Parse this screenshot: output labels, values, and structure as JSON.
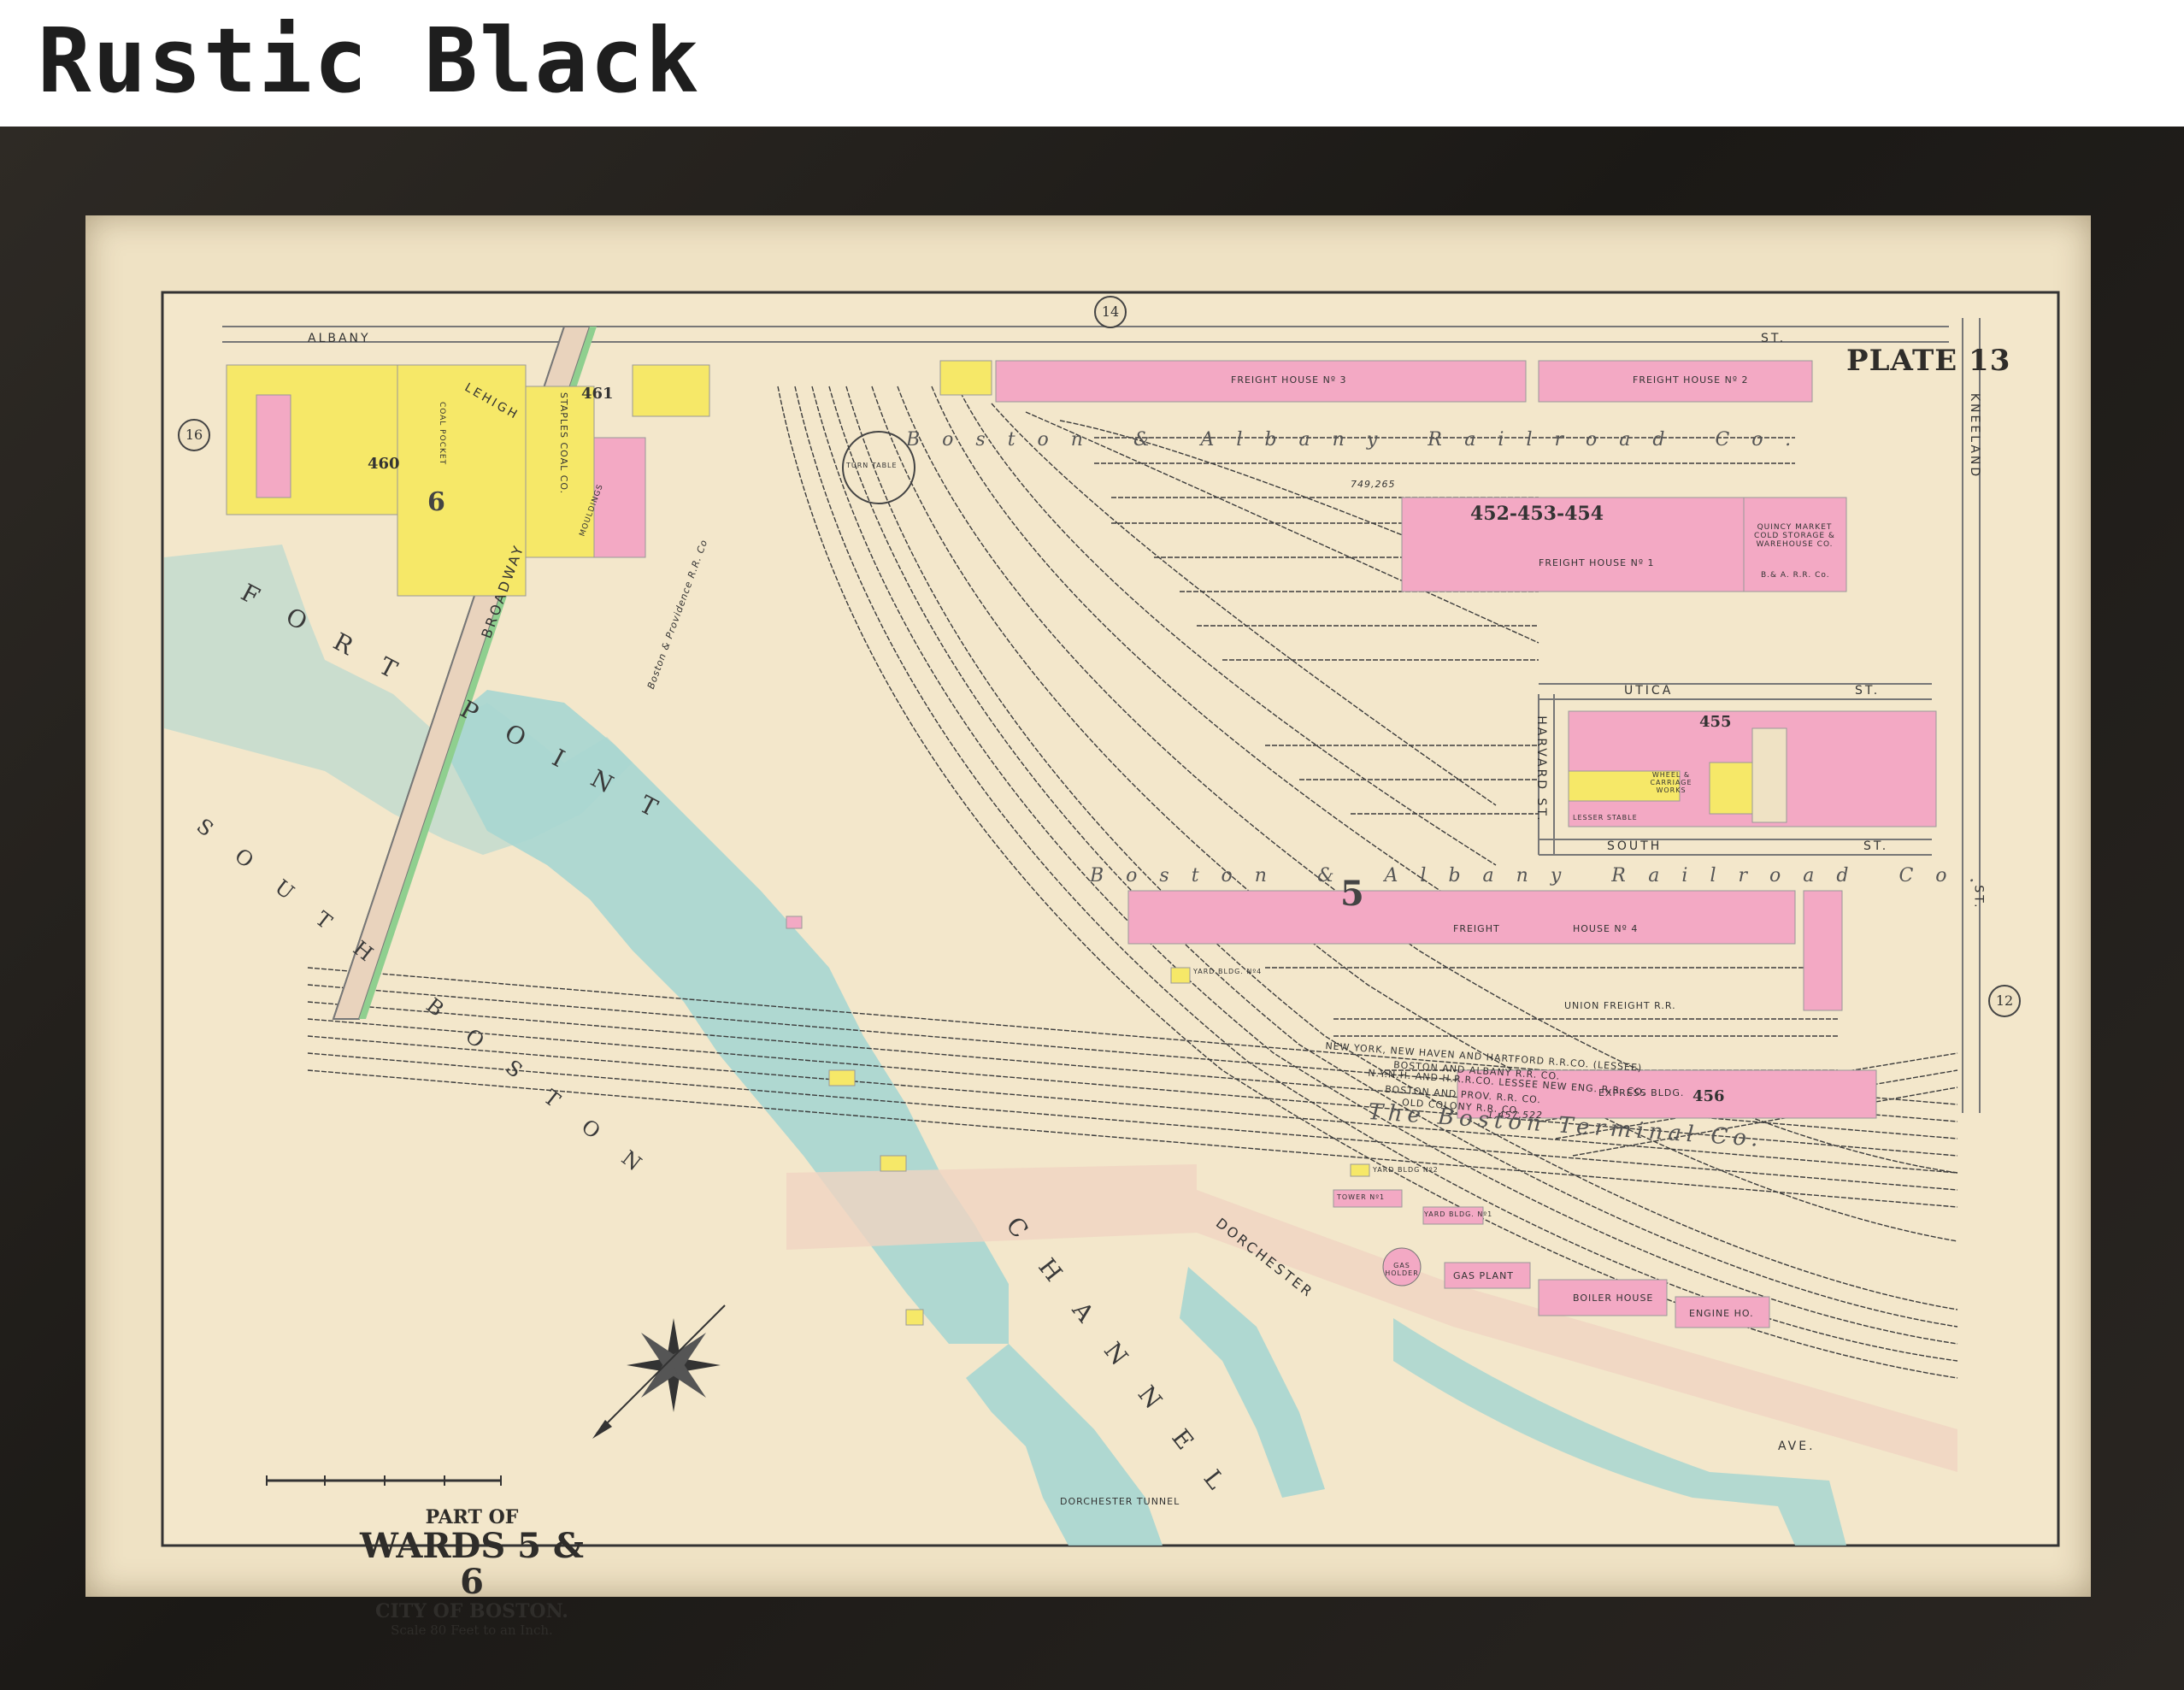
{
  "header": {
    "title": "Rustic Black"
  },
  "plate": {
    "title": "PLATE 13",
    "caption": {
      "line1": "PART OF",
      "line2": "WARDS 5 & 6",
      "line3": "CITY OF BOSTON.",
      "line4": "Scale 80 Feet to an Inch."
    },
    "plate_refs": [
      "14",
      "16",
      "12"
    ],
    "ward_numbers": [
      "5",
      "6"
    ],
    "lot_numbers": [
      "460",
      "461",
      "452-453-454",
      "455",
      "456",
      "749,265",
      "1,457,522"
    ],
    "streets": {
      "albany": "ALBANY",
      "albany_st": "ST.",
      "lehigh": "LEHIGH",
      "broadway": "BROADWAY",
      "kneeland": "KNEELAND",
      "kneeland_st": "ST.",
      "utica": "UTICA",
      "utica_st": "ST.",
      "harvard": "HARVARD ST.",
      "south": "SOUTH",
      "south_st": "ST.",
      "dorchester": "DORCHESTER",
      "ave": "AVE."
    },
    "water": {
      "fort_point": "FORT POINT",
      "channel": "CHANNEL",
      "south_boston": "SOUTH BOSTON",
      "dorchester_tunnel": "DORCHESTER TUNNEL"
    },
    "railroads": {
      "ba_top": "Boston & Albany Railroad Co.",
      "ba_bottom": "Boston & Albany Railroad Co.",
      "bp": "Boston & Providence R.R. Co",
      "union": "UNION FREIGHT R.R.",
      "nyhh": "NEW YORK, NEW HAVEN AND HARTFORD R.R.CO. (LESSEE)",
      "ba_co": "BOSTON AND ALBANY R.R. CO.",
      "nynh_lessee": "N.Y.N.H. AND H.R.R.CO. LESSEE NEW ENG. R.R. CO.",
      "bprov": "BOSTON AND PROV. R.R. CO.",
      "oldcolony": "OLD COLONY R.R. CO.",
      "terminal": "The Boston Terminal Co."
    },
    "buildings": {
      "fh3": "FREIGHT HOUSE Nº 3",
      "fh2": "FREIGHT HOUSE Nº 2",
      "fh1": "FREIGHT HOUSE Nº 1",
      "fh4_a": "FREIGHT",
      "fh4_b": "HOUSE Nº 4",
      "quincy": "QUINCY MARKET COLD STORAGE & WAREHOUSE CO.",
      "quincy_sub": "B.& A. R.R. Co.",
      "express": "EXPRESS BLDG.",
      "turntable": "TURN TABLE",
      "yard4": "YARD BLDG. Nº4",
      "yard2": "YARD BLDG Nº2",
      "yard1": "YARD BLDG. Nº1",
      "tower": "TOWER Nº1",
      "gas_holder": "GAS HOLDER",
      "gas_plant": "GAS PLANT",
      "boiler": "BOILER HOUSE",
      "engine": "ENGINE HO.",
      "coal_pocket": "COAL POCKET",
      "staples": "STAPLES COAL CO.",
      "wheel": "WHEEL & CARRIAGE WORKS",
      "lesser": "LESSER STABLE",
      "mouldings": "MOULDINGS"
    }
  },
  "colors": {
    "frame": "#1f1c19",
    "paper": "#f3e7cb",
    "water": "#a7d6d1",
    "pink": "#f3a9c4",
    "yellow": "#f6e868",
    "ink": "#333333"
  }
}
